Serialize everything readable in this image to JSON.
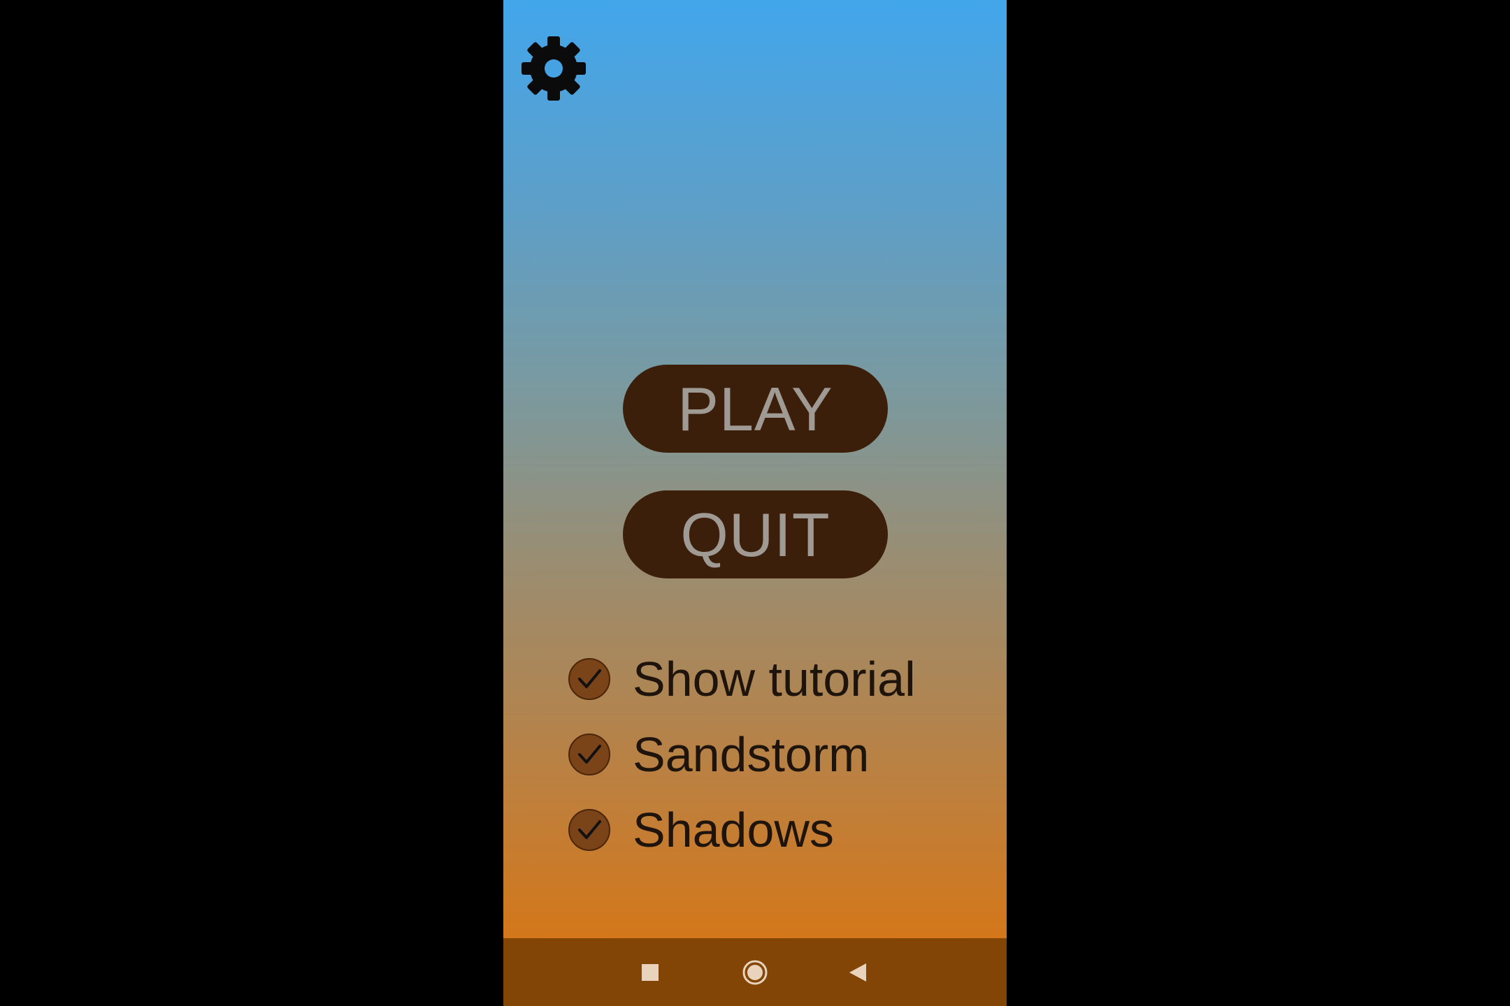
{
  "menu": {
    "play_label": "PLAY",
    "quit_label": "QUIT"
  },
  "options": [
    {
      "label": "Show tutorial",
      "checked": true
    },
    {
      "label": "Sandstorm",
      "checked": true
    },
    {
      "label": "Shadows",
      "checked": true
    }
  ],
  "icons": {
    "settings": "gear-icon",
    "checkbox_checked": "check-icon",
    "nav_recent": "square-icon",
    "nav_home": "circle-icon",
    "nav_back": "triangle-back-icon"
  },
  "colors": {
    "sky_top": "#42a6eb",
    "sand_bottom": "#d4771a",
    "button_bg": "#3c1f0b",
    "button_text": "#a09a94",
    "checkbox_fill": "#7a4318",
    "label_text": "#1f140c",
    "navbar_bg": "#824506",
    "navbar_icons": "#e9d3bd",
    "letterbox": "#000000"
  }
}
